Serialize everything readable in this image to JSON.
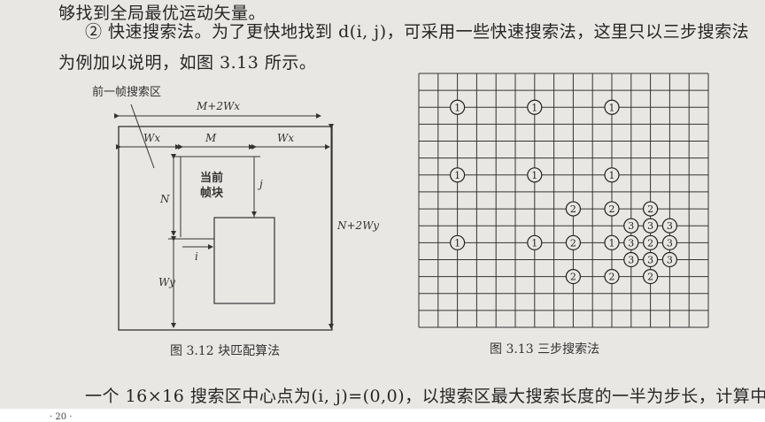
{
  "text": {
    "line1": "够找到全局最优运动矢量。",
    "line2": "② 快速搜索法。为了更快地找到 d(i, j)，可采用一些快速搜索法，这里只以三步搜索法",
    "line3": "为例加以说明，如图 3.13 所示。",
    "bottom": "一个 16×16 搜索区中心点为(i, j)=(0,0)，以搜索区最大搜索长度的一半为步长，计算中心",
    "page_number": "· 20 ·"
  },
  "fig312": {
    "region_label": "前一帧搜索区",
    "width_label": "M+2Wx",
    "wx_left": "Wx",
    "m_label": "M",
    "wx_right": "Wx",
    "height_label": "N+2Wy",
    "current_block": "当前",
    "current_block2": "帧块",
    "n_label": "N",
    "j_label": "j",
    "i_label": "i",
    "wy_label": "Wy",
    "caption": "图 3.12   块匹配算法"
  },
  "fig313": {
    "grid_size": 15,
    "caption": "图 3.13   三步搜索法",
    "step1_points": [
      [
        2,
        2
      ],
      [
        6,
        2
      ],
      [
        10,
        2
      ],
      [
        2,
        6
      ],
      [
        6,
        6
      ],
      [
        10,
        6
      ],
      [
        2,
        10
      ],
      [
        6,
        10
      ],
      [
        10,
        10
      ]
    ],
    "step2_points": [
      [
        8,
        8
      ],
      [
        10,
        8
      ],
      [
        12,
        8
      ],
      [
        8,
        10
      ],
      [
        12,
        10
      ],
      [
        8,
        12
      ],
      [
        10,
        12
      ],
      [
        12,
        12
      ]
    ],
    "step3_points": [
      [
        11,
        9
      ],
      [
        12,
        9
      ],
      [
        13,
        9
      ],
      [
        11,
        10
      ],
      [
        13,
        10
      ],
      [
        11,
        11
      ],
      [
        12,
        11
      ],
      [
        13,
        11
      ]
    ],
    "step1_label": "1",
    "step2_label": "2",
    "step3_label": "3"
  }
}
